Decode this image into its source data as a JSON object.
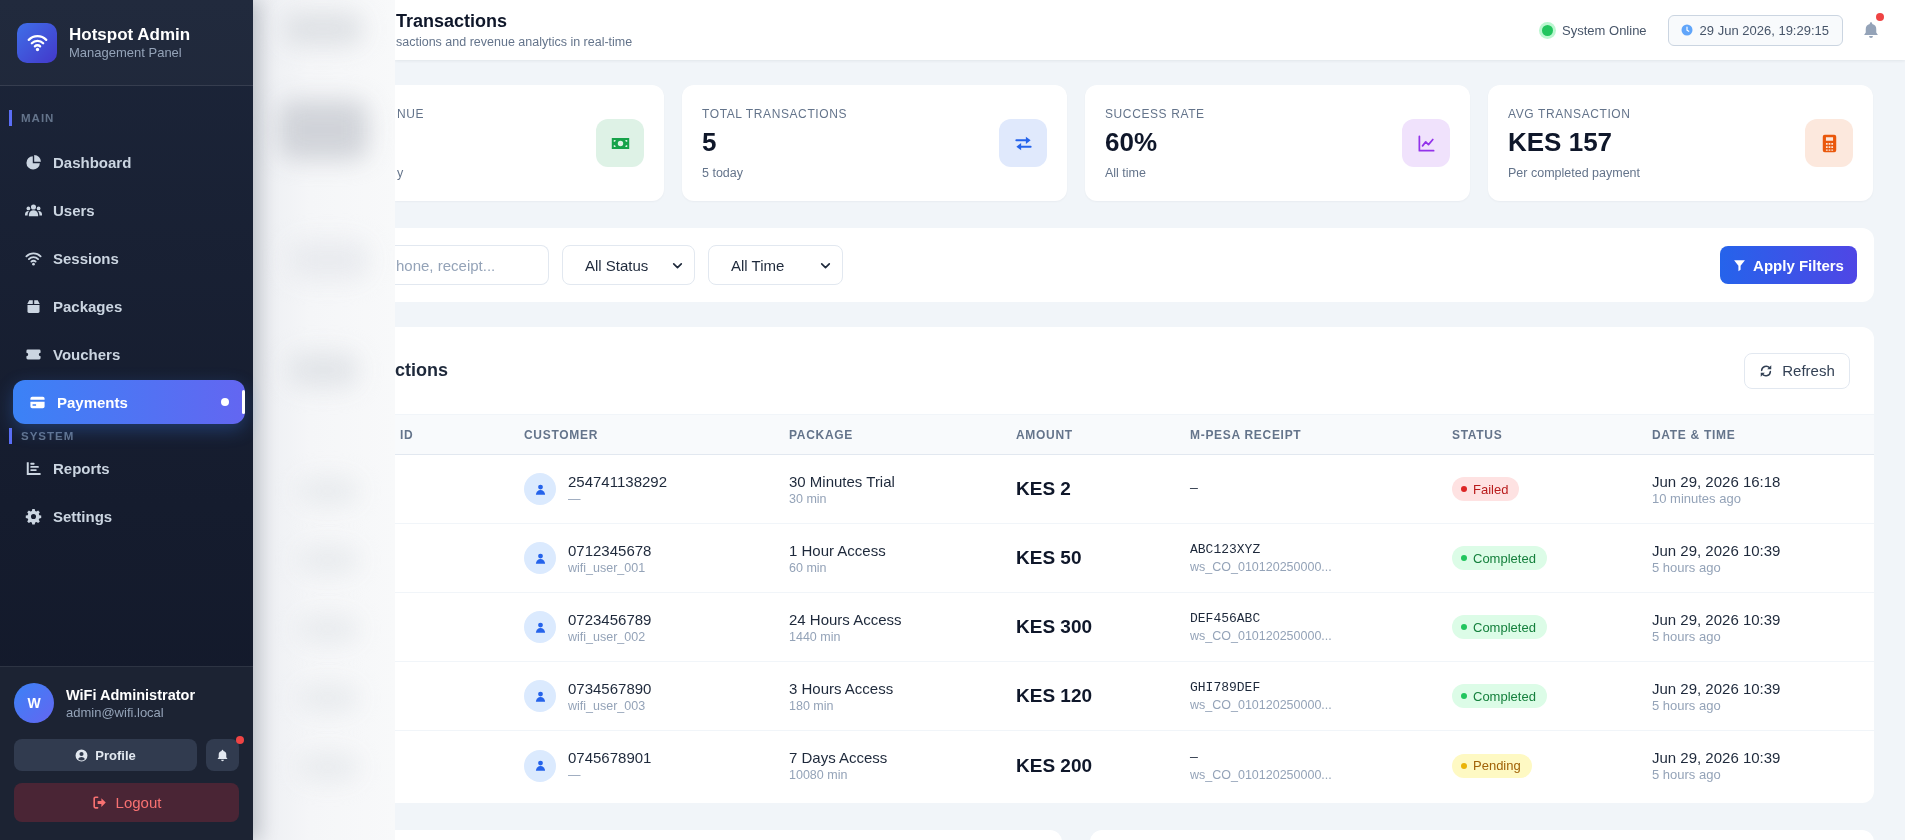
{
  "sidebar": {
    "brand": {
      "title": "Hotspot Admin",
      "subtitle": "Management Panel"
    },
    "sections": [
      {
        "label": "MAIN",
        "items": [
          {
            "label": "Dashboard",
            "selected": false
          },
          {
            "label": "Users",
            "selected": false
          },
          {
            "label": "Sessions",
            "selected": false
          },
          {
            "label": "Packages",
            "selected": false
          },
          {
            "label": "Vouchers",
            "selected": false
          },
          {
            "label": "Payments",
            "selected": true
          }
        ]
      },
      {
        "label": "SYSTEM",
        "items": [
          {
            "label": "Reports",
            "selected": false
          },
          {
            "label": "Settings",
            "selected": false
          }
        ]
      }
    ],
    "user": {
      "initial": "W",
      "name": "WiFi Administrator",
      "email": "admin@wifi.local"
    },
    "profile_button": "Profile",
    "notifications_unread": true,
    "logout_button": "Logout"
  },
  "header": {
    "title": "Transactions",
    "subtitle": "sactions and revenue analytics in real-time",
    "status": {
      "label": "System Online",
      "online": true
    },
    "datetime": "29 Jun 2026, 19:29:15",
    "notifications_unread": true
  },
  "stats": [
    {
      "label": "NUE",
      "sub": "y",
      "color": "#16a34a"
    },
    {
      "label": "TOTAL TRANSACTIONS",
      "value": "5",
      "sub": "5 today",
      "color": "#2563eb"
    },
    {
      "label": "SUCCESS RATE",
      "value": "60%",
      "sub": "All time",
      "color": "#9333ea"
    },
    {
      "label": "AVG TRANSACTION",
      "value": "KES 157",
      "sub": "Per completed payment",
      "color": "#ea580c"
    }
  ],
  "filters": {
    "search": {
      "placeholder": "hone, receipt..."
    },
    "selects": [
      {
        "value": "All Status"
      },
      {
        "value": "All Time"
      }
    ],
    "apply_button": "Apply Filters"
  },
  "table": {
    "title": "ctions",
    "refresh_button": "Refresh",
    "columns": [
      "ID",
      "CUSTOMER",
      "PACKAGE",
      "AMOUNT",
      "M-PESA RECEIPT",
      "STATUS",
      "DATE & TIME"
    ],
    "rows": [
      {
        "customer": "254741138292",
        "customer_sub": "—",
        "package": "30 Minutes Trial",
        "package_sub": "30 min",
        "amount": "KES 2",
        "receipt": "—",
        "status": {
          "label": "Failed",
          "kind": "failed"
        },
        "date": "Jun 29, 2026 16:18",
        "date_sub": "10 minutes ago"
      },
      {
        "customer": "0712345678",
        "customer_sub": "wifi_user_001",
        "package": "1 Hour Access",
        "package_sub": "60 min",
        "amount": "KES 50",
        "receipt": "ABC123XYZ",
        "receipt_sub": "ws_CO_010120250000...",
        "status": {
          "label": "Completed",
          "kind": "completed"
        },
        "date": "Jun 29, 2026 10:39",
        "date_sub": "5 hours ago"
      },
      {
        "customer": "0723456789",
        "customer_sub": "wifi_user_002",
        "package": "24 Hours Access",
        "package_sub": "1440 min",
        "amount": "KES 300",
        "receipt": "DEF456ABC",
        "receipt_sub": "ws_CO_010120250000...",
        "status": {
          "label": "Completed",
          "kind": "completed"
        },
        "date": "Jun 29, 2026 10:39",
        "date_sub": "5 hours ago"
      },
      {
        "customer": "0734567890",
        "customer_sub": "wifi_user_003",
        "package": "3 Hours Access",
        "package_sub": "180 min",
        "amount": "KES 120",
        "receipt": "GHI789DEF",
        "receipt_sub": "ws_CO_010120250000...",
        "status": {
          "label": "Completed",
          "kind": "completed"
        },
        "date": "Jun 29, 2026 10:39",
        "date_sub": "5 hours ago"
      },
      {
        "customer": "0745678901",
        "customer_sub": "—",
        "package": "7 Days Access",
        "package_sub": "10080 min",
        "amount": "KES 200",
        "receipt": "—",
        "receipt_sub": "ws_CO_010120250000...",
        "status": {
          "label": "Pending",
          "kind": "pending"
        },
        "date": "Jun 29, 2026 10:39",
        "date_sub": "5 hours ago"
      }
    ]
  }
}
